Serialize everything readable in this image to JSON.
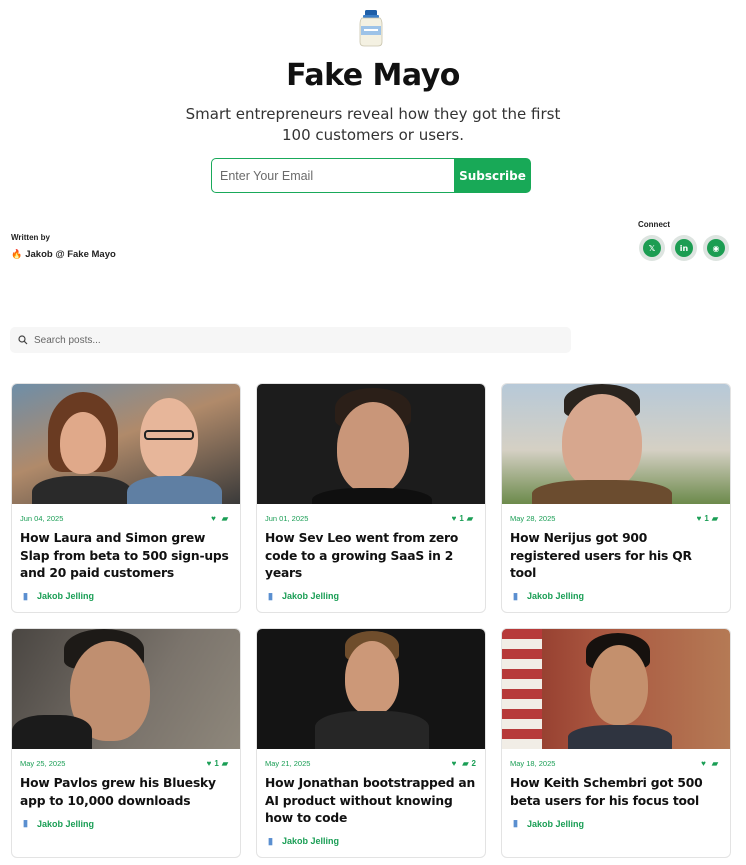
{
  "brand": {
    "title": "Fake Mayo",
    "tagline": "Smart entrepreneurs reveal how they got the first 100 customers or users.",
    "logo_icon": "mayo-jar-icon"
  },
  "subscribe": {
    "placeholder": "Enter Your Email",
    "button_label": "Subscribe"
  },
  "author": {
    "written_by_label": "Written by",
    "name": "Jakob @ Fake Mayo"
  },
  "connect": {
    "label": "Connect",
    "links": [
      {
        "icon": "x-icon",
        "glyph": "𝕏"
      },
      {
        "icon": "linkedin-icon",
        "glyph": "in"
      },
      {
        "icon": "rss-icon",
        "glyph": "◉"
      }
    ]
  },
  "search": {
    "placeholder": "Search posts..."
  },
  "colors": {
    "accent": "#18a957"
  },
  "posts": [
    {
      "date": "Jun 04, 2025",
      "likes": "",
      "comments": "",
      "title": "How Laura and Simon grew Slap from beta to 500 sign-ups and 20 paid customers",
      "author": "Jakob Jelling"
    },
    {
      "date": "Jun 01, 2025",
      "likes": "1",
      "comments": "",
      "title": "How Sev Leo went from zero code to a growing SaaS in 2 years",
      "author": "Jakob Jelling"
    },
    {
      "date": "May 28, 2025",
      "likes": "1",
      "comments": "",
      "title": "How Nerijus got 900 registered users for his QR tool",
      "author": "Jakob Jelling"
    },
    {
      "date": "May 25, 2025",
      "likes": "1",
      "comments": "",
      "title": "How Pavlos grew his Bluesky app to 10,000 downloads",
      "author": "Jakob Jelling"
    },
    {
      "date": "May 21, 2025",
      "likes": "",
      "comments": "2",
      "title": "How Jonathan bootstrapped an AI product without knowing how to code",
      "author": "Jakob Jelling"
    },
    {
      "date": "May 18, 2025",
      "likes": "",
      "comments": "",
      "title": "How Keith Schembri got 500 beta users for his focus tool",
      "author": "Jakob Jelling"
    }
  ]
}
